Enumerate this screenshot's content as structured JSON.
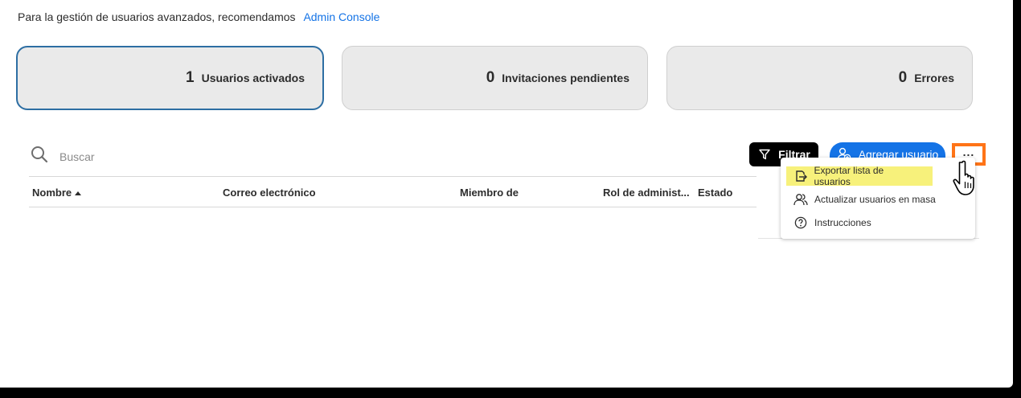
{
  "intro": {
    "text": "Para la gestión de usuarios avanzados, recomendamos",
    "link": "Admin Console"
  },
  "cards": [
    {
      "count": "1",
      "label": "Usuarios activados",
      "selected": true
    },
    {
      "count": "0",
      "label": "Invitaciones pendientes",
      "selected": false
    },
    {
      "count": "0",
      "label": "Errores",
      "selected": false
    }
  ],
  "search": {
    "placeholder": "Buscar",
    "icon": "search-icon"
  },
  "toolbar": {
    "filter_label": "Filtrar",
    "add_user_label": "Agregar usuario",
    "more_label": "..."
  },
  "table": {
    "columns": [
      "Nombre",
      "Correo electrónico",
      "Miembro de",
      "Rol de administ...",
      "Estado"
    ],
    "sort_column": "Nombre",
    "sort_direction": "ascending"
  },
  "menu": {
    "items": [
      {
        "label": "Exportar lista de usuarios",
        "icon": "export-icon",
        "highlighted": true
      },
      {
        "label": "Actualizar usuarios en masa",
        "icon": "users-icon",
        "highlighted": false
      },
      {
        "label": "Instrucciones",
        "icon": "help-icon",
        "highlighted": false
      }
    ]
  },
  "colors": {
    "link": "#1473e6",
    "primary_button": "#1473e6",
    "filter_button": "#000000",
    "more_button_outline": "#ff7417",
    "highlight": "#f7f17b",
    "selected_card_border": "#2d6ea3"
  }
}
